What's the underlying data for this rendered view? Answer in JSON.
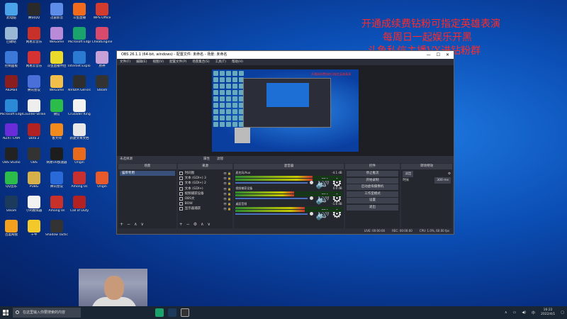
{
  "desktop": {
    "icons": [
      {
        "label": "此电脑",
        "color": "#4aa3e8"
      },
      {
        "label": "腾讯QQ",
        "color": "#2a2a2a"
      },
      {
        "label": "迅雷影音",
        "color": "#5d8de8"
      },
      {
        "label": "斗鱼直播",
        "color": "#f26b1d"
      },
      {
        "label": "WPS Office",
        "color": "#d23b2d"
      },
      {
        "label": "回收站",
        "color": "#9ab7d6"
      },
      {
        "label": "网易云音乐",
        "color": "#c8302a"
      },
      {
        "label": "WeGame",
        "color": "#b98ad8"
      },
      {
        "label": "Microsoft Edge",
        "color": "#1aa36c"
      },
      {
        "label": "CheatEngine",
        "color": "#d84a6b"
      },
      {
        "label": "控制面板",
        "color": "#3b78d8"
      },
      {
        "label": "网易云音乐",
        "color": "#d63232"
      },
      {
        "label": "斗鱼直播伴侣",
        "color": "#eadb2b"
      },
      {
        "label": "Internet Explorer",
        "color": "#2c7bd2"
      },
      {
        "label": "原神",
        "color": "#c8a0d8"
      },
      {
        "label": "AIDA64",
        "color": "#8a1d1d"
      },
      {
        "label": "腾讯会议",
        "color": "#4a6fd8"
      },
      {
        "label": "WeGame",
        "color": "#f2c04a"
      },
      {
        "label": "NVIDIA GeForce",
        "color": "#2e2e2e"
      },
      {
        "label": "Steam",
        "color": "#333"
      },
      {
        "label": "Microsoft Edge",
        "color": "#2b8ad8"
      },
      {
        "label": "Counter-Strike",
        "color": "#eeeeee"
      },
      {
        "label": "微信",
        "color": "#2bbc4a"
      },
      {
        "label": "Crusader Kings",
        "color": "#f2f2f2"
      },
      {
        "label": "",
        "color": "transparent"
      },
      {
        "label": "NZXT CAM",
        "color": "#6a2bd8"
      },
      {
        "label": "Dota 2",
        "color": "#b22222"
      },
      {
        "label": "鲁大师",
        "color": "#f28a1d"
      },
      {
        "label": "新建文本文档",
        "color": "#e8e8e8"
      },
      {
        "label": "",
        "color": "transparent"
      },
      {
        "label": "OBS Studio",
        "color": "#222"
      },
      {
        "label": "OBS",
        "color": "#333"
      },
      {
        "label": "网易UU加速器",
        "color": "#1d1d1d"
      },
      {
        "label": "Origin",
        "color": "#e86a1d"
      },
      {
        "label": "",
        "color": "transparent"
      },
      {
        "label": "QQ音乐",
        "color": "#2bbc4a"
      },
      {
        "label": "PUBG",
        "color": "#d8b04a"
      },
      {
        "label": "腾讯会议",
        "color": "#2a6ad8"
      },
      {
        "label": "Among Us",
        "color": "#c83030"
      },
      {
        "label": "Origin",
        "color": "#e85a2a"
      },
      {
        "label": "Steam",
        "color": "#1b3a5c"
      },
      {
        "label": "小鸡模拟器",
        "color": "#f2f2f2"
      },
      {
        "label": "Among Us",
        "color": "#c8302a"
      },
      {
        "label": "Call of Duty",
        "color": "#b22222"
      },
      {
        "label": "",
        "color": "transparent"
      },
      {
        "label": "百度网盘",
        "color": "#f2a01d"
      },
      {
        "label": "千牛",
        "color": "#f2c82b"
      },
      {
        "label": "Shadow Tactics",
        "color": "#333"
      },
      {
        "label": "",
        "color": "transparent"
      },
      {
        "label": "",
        "color": "transparent"
      }
    ]
  },
  "overlay": {
    "line1": "开通成续费钻粉可指定英雄表演",
    "line2": "每周日一起娱乐开黑",
    "line3": "斗鱼私信主播VX进钻粉群"
  },
  "obs": {
    "title": "OBS 26.1.1 (64-bit, windows) - 配置文件: 未命名 - 场景: 未命名",
    "window_buttons": [
      "—",
      "☐",
      "✕"
    ],
    "menu": [
      "文件(F)",
      "编辑(E)",
      "视图(V)",
      "配置文件(P)",
      "场景集合(S)",
      "工具(T)",
      "帮助(H)"
    ],
    "preview_red_text": "开通成续费钻粉可指定英雄表演",
    "toolbar_label": "未选择源",
    "toolbar_props": "属性",
    "toolbar_filters": "滤镜",
    "docks": {
      "scenes_title": "场景",
      "sources_title": "来源",
      "mixer_title": "混音器",
      "transitions_title": "转场特效",
      "controls_title": "控件"
    },
    "scenes": [
      "猫带专用"
    ],
    "sources": [
      "时间图",
      "文本 (GDI+) 3",
      "文本 (GDI+) 2",
      "文本 (GDI+)",
      "视频捕获设备",
      "OBS文",
      "BOW",
      "显示器捕获"
    ],
    "mixer": [
      {
        "name": "麦克风/Aux",
        "db": "-4.1 dB",
        "level": 0.72
      },
      {
        "name": "视频捕获设备",
        "db": "0.0 dB",
        "level": 0.55
      },
      {
        "name": "桌面音频",
        "db": "-1.6 dB",
        "level": 0.65
      }
    ],
    "controls": [
      "停止推流",
      "开始录制",
      "启动虚拟摄像机",
      "工作室模式",
      "设置",
      "退出"
    ],
    "transition_select": "淡出",
    "duration_label": "时长",
    "duration_value": "300 ms",
    "status": {
      "live": "LIVE: 00:00:00",
      "rec": "REC: 00:00:00",
      "cpu": "CPU: 1.0%, 60.00 fps"
    }
  },
  "taskbar": {
    "search_placeholder": "在这里输入你要搜索的内容",
    "time": "16:22",
    "date": "2022/4/1",
    "lang": "中"
  }
}
